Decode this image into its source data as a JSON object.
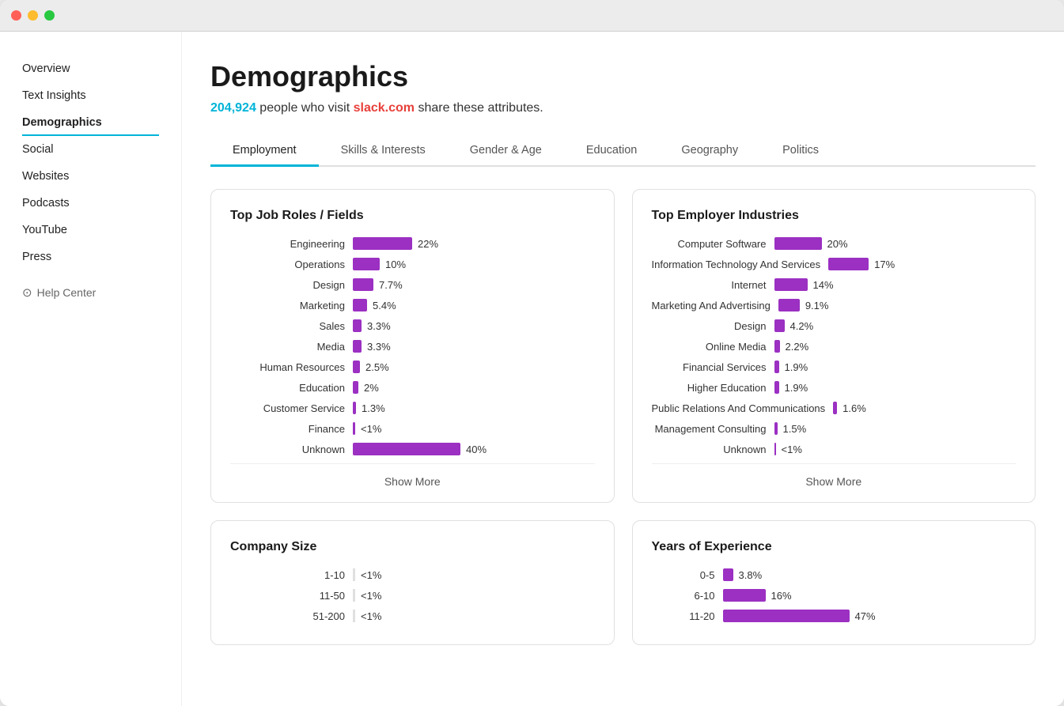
{
  "window": {
    "titlebar": {
      "btn_red": "close",
      "btn_yellow": "minimize",
      "btn_green": "maximize"
    }
  },
  "sidebar": {
    "items": [
      {
        "id": "overview",
        "label": "Overview",
        "active": false
      },
      {
        "id": "text-insights",
        "label": "Text Insights",
        "active": false
      },
      {
        "id": "demographics",
        "label": "Demographics",
        "active": true
      },
      {
        "id": "social",
        "label": "Social",
        "active": false
      },
      {
        "id": "websites",
        "label": "Websites",
        "active": false
      },
      {
        "id": "podcasts",
        "label": "Podcasts",
        "active": false
      },
      {
        "id": "youtube",
        "label": "YouTube",
        "active": false
      },
      {
        "id": "press",
        "label": "Press",
        "active": false
      }
    ],
    "help_label": "Help Center"
  },
  "page": {
    "title": "Demographics",
    "subtitle_prefix": " people who visit ",
    "subtitle_suffix": " share these attributes.",
    "count": "204,924",
    "site": "slack.com"
  },
  "tabs": [
    {
      "id": "employment",
      "label": "Employment",
      "active": true
    },
    {
      "id": "skills",
      "label": "Skills & Interests",
      "active": false
    },
    {
      "id": "gender",
      "label": "Gender & Age",
      "active": false
    },
    {
      "id": "education",
      "label": "Education",
      "active": false
    },
    {
      "id": "geography",
      "label": "Geography",
      "active": false
    },
    {
      "id": "politics",
      "label": "Politics",
      "active": false
    }
  ],
  "cards": {
    "job_roles": {
      "title": "Top Job Roles / Fields",
      "max_bar_width": 160,
      "rows": [
        {
          "label": "Engineering",
          "value": "22%",
          "pct": 22
        },
        {
          "label": "Operations",
          "value": "10%",
          "pct": 10
        },
        {
          "label": "Design",
          "value": "7.7%",
          "pct": 7.7
        },
        {
          "label": "Marketing",
          "value": "5.4%",
          "pct": 5.4
        },
        {
          "label": "Sales",
          "value": "3.3%",
          "pct": 3.3
        },
        {
          "label": "Media",
          "value": "3.3%",
          "pct": 3.3
        },
        {
          "label": "Human Resources",
          "value": "2.5%",
          "pct": 2.5
        },
        {
          "label": "Education",
          "value": "2%",
          "pct": 2
        },
        {
          "label": "Customer Service",
          "value": "1.3%",
          "pct": 1.3
        },
        {
          "label": "Finance",
          "value": "<1%",
          "pct": 0.8
        },
        {
          "label": "Unknown",
          "value": "40%",
          "pct": 40
        }
      ],
      "show_more": "Show More"
    },
    "employer_industries": {
      "title": "Top Employer Industries",
      "max_bar_width": 160,
      "rows": [
        {
          "label": "Computer Software",
          "value": "20%",
          "pct": 20
        },
        {
          "label": "Information Technology And Services",
          "value": "17%",
          "pct": 17
        },
        {
          "label": "Internet",
          "value": "14%",
          "pct": 14
        },
        {
          "label": "Marketing And Advertising",
          "value": "9.1%",
          "pct": 9.1
        },
        {
          "label": "Design",
          "value": "4.2%",
          "pct": 4.2
        },
        {
          "label": "Online Media",
          "value": "2.2%",
          "pct": 2.2
        },
        {
          "label": "Financial Services",
          "value": "1.9%",
          "pct": 1.9
        },
        {
          "label": "Higher Education",
          "value": "1.9%",
          "pct": 1.9
        },
        {
          "label": "Public Relations And Communications",
          "value": "1.6%",
          "pct": 1.6
        },
        {
          "label": "Management Consulting",
          "value": "1.5%",
          "pct": 1.5
        },
        {
          "label": "Unknown",
          "value": "<1%",
          "pct": 0.8
        }
      ],
      "show_more": "Show More"
    },
    "company_size": {
      "title": "Company Size",
      "rows": [
        {
          "label": "1-10",
          "value": "<1%"
        },
        {
          "label": "11-50",
          "value": "<1%"
        },
        {
          "label": "51-200",
          "value": "<1%"
        }
      ]
    },
    "years_experience": {
      "title": "Years of Experience",
      "max_bar_width": 160,
      "rows": [
        {
          "label": "0-5",
          "value": "3.8%",
          "pct": 3.8
        },
        {
          "label": "6-10",
          "value": "16%",
          "pct": 16
        },
        {
          "label": "11-20",
          "value": "47%",
          "pct": 47
        }
      ]
    }
  }
}
